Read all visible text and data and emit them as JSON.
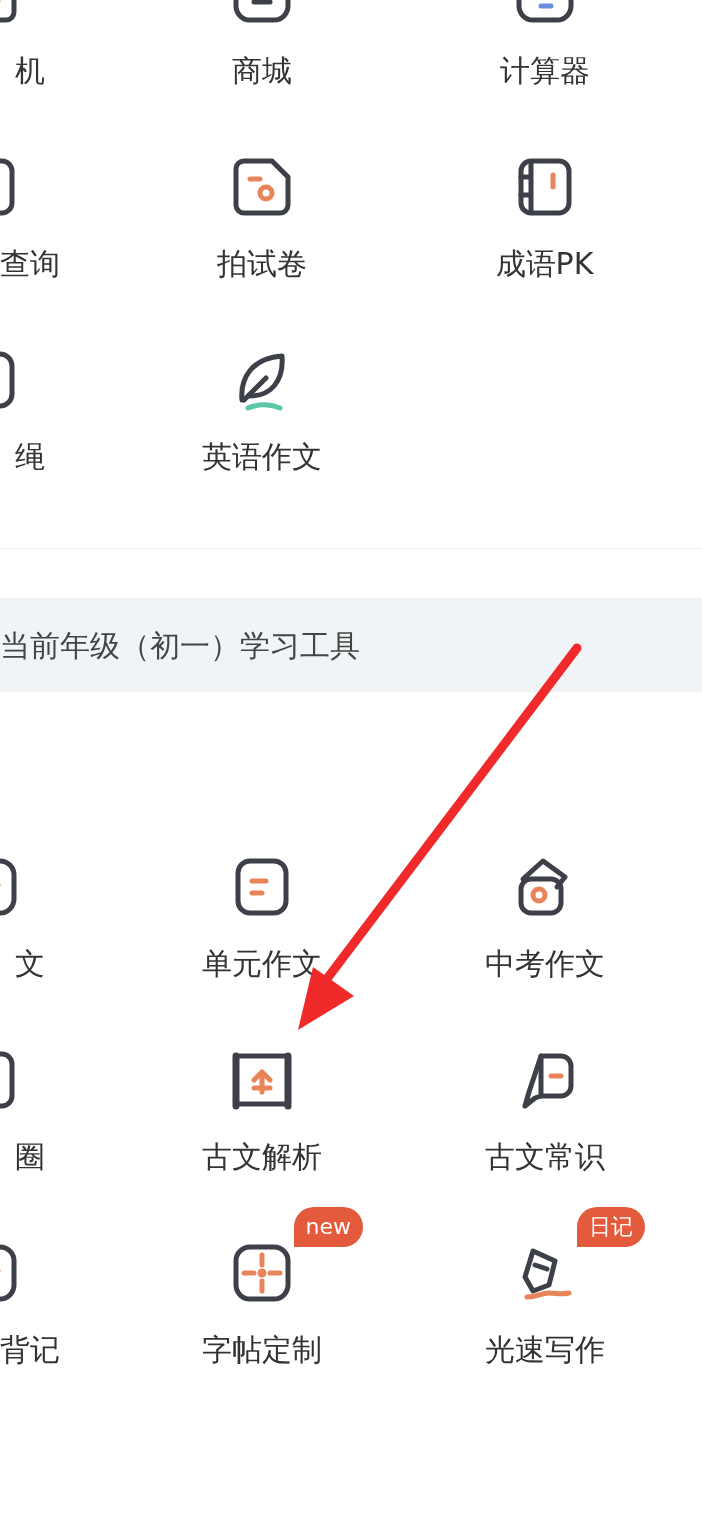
{
  "top_grid": {
    "items": [
      {
        "label": "机"
      },
      {
        "label": "商城"
      },
      {
        "label": "计算器"
      },
      {
        "label": "查询"
      },
      {
        "label": "拍试卷"
      },
      {
        "label": "成语PK"
      },
      {
        "label": "绳"
      },
      {
        "label": "英语作文"
      }
    ]
  },
  "section": {
    "title": "当前年级（初一）学习工具"
  },
  "tools": [
    {
      "label": "文"
    },
    {
      "label": "单元作文"
    },
    {
      "label": "中考作文"
    },
    {
      "label": "圈"
    },
    {
      "label": "古文解析"
    },
    {
      "label": "古文常识"
    },
    {
      "label": "背记"
    },
    {
      "label": "字帖定制",
      "badge": "new"
    },
    {
      "label": "光速写作",
      "badge": "日记"
    }
  ]
}
